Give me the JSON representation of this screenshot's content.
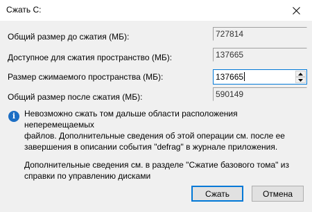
{
  "window": {
    "title": "Сжать C:"
  },
  "fields": {
    "total_before": {
      "label": "Общий размер до сжатия (МБ):",
      "value": "727814"
    },
    "available": {
      "label": "Доступное для сжатия пространство (МБ):",
      "value": "137665"
    },
    "shrink_amount": {
      "label": "Размер сжимаемого пространства (МБ):",
      "value": "137665"
    },
    "total_after": {
      "label": "Общий размер после сжатия (МБ):",
      "value": "590149"
    }
  },
  "info": {
    "icon": "info-icon",
    "lines": [
      "Невозможно сжать том дальше области расположения неперемещаемых",
      "файлов. Дополнительные сведения об этой операции см. после ее",
      "завершения в описании события \"defrag\" в журнале приложения."
    ]
  },
  "more_info": {
    "lines": [
      "Дополнительные сведения см. в разделе \"Сжатие базового тома\" из",
      "справки по управлению дисками"
    ]
  },
  "buttons": {
    "shrink": "Сжать",
    "cancel": "Отмена"
  },
  "colors": {
    "accent": "#0078d7",
    "info": "#1c6ec4"
  }
}
